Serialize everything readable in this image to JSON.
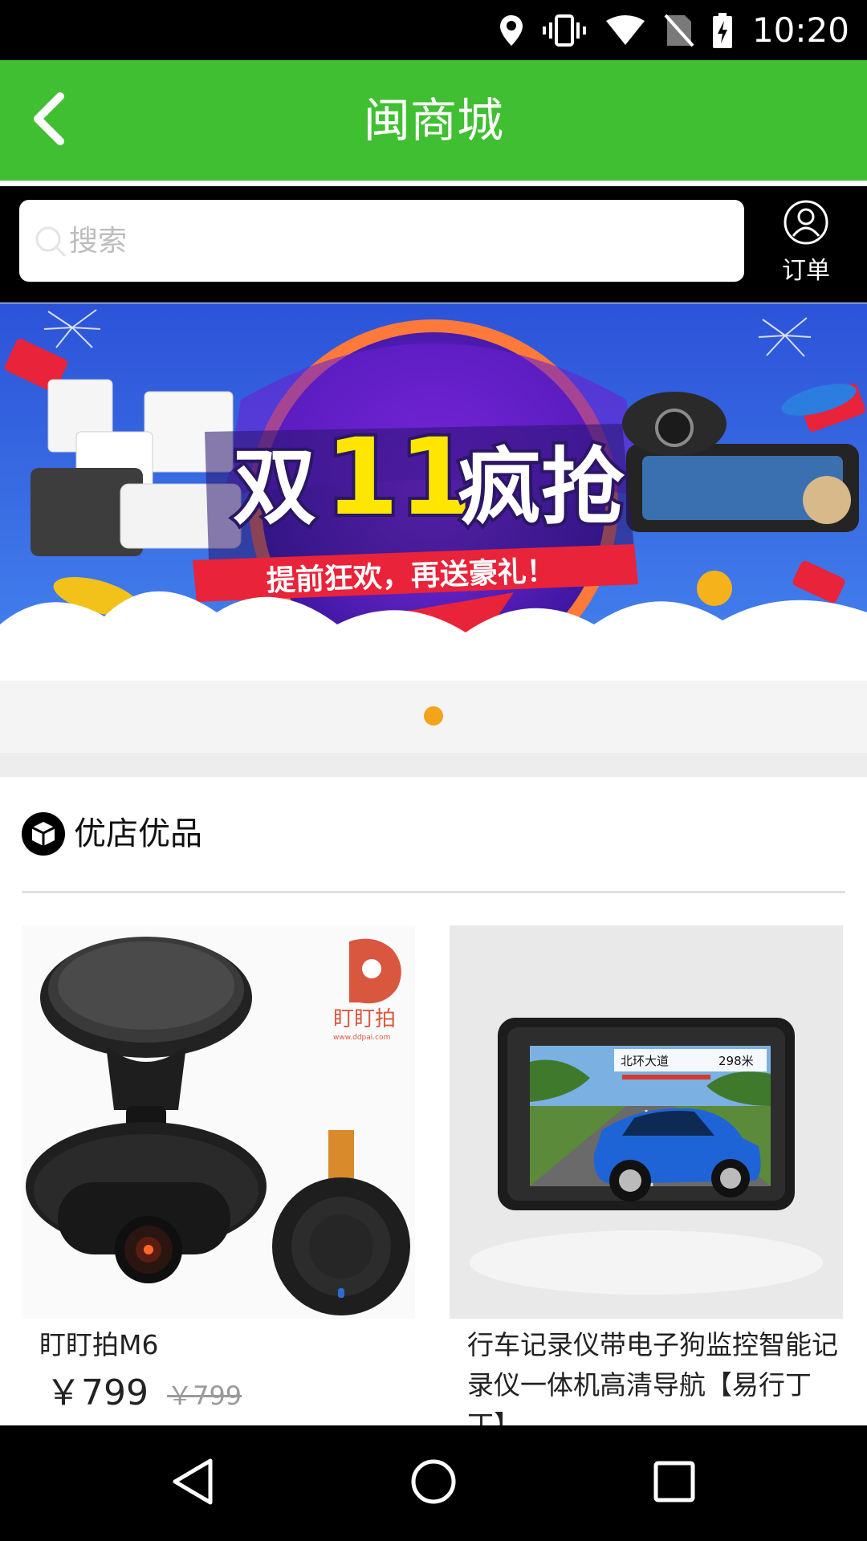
{
  "status_bar": {
    "time": "10:20",
    "icons": [
      "location-icon",
      "vibrate-icon",
      "wifi-icon",
      "no-sim-icon",
      "battery-charging-icon"
    ]
  },
  "header": {
    "title": "闽商城",
    "back_icon": "chevron-left-icon",
    "bg_color": "#40bf32"
  },
  "search": {
    "placeholder": "搜索",
    "orders_label": "订单",
    "orders_icon": "user-icon"
  },
  "banner": {
    "headline_prefix": "双",
    "headline_number": "11",
    "headline_suffix": "疯抢",
    "tagline": "提前狂欢，再送豪礼！",
    "active_index": 0,
    "dot_color": "#f4a31a"
  },
  "section": {
    "title": "优店优品",
    "icon": "box-icon"
  },
  "products": [
    {
      "name": "盯盯拍M6",
      "price": "￥799",
      "original_price": "￥799",
      "brand_logo_text": "盯盯拍",
      "brand_url": "www.ddpai.com"
    },
    {
      "name": "行车记录仪带电子狗监控智能记录仪一体机高清导航【易行丁丁】",
      "screen_road_label": "北环大道",
      "screen_distance": "298米"
    }
  ],
  "nav_bar": {
    "icons": [
      "back-triangle-icon",
      "home-circle-icon",
      "recents-square-icon"
    ]
  }
}
